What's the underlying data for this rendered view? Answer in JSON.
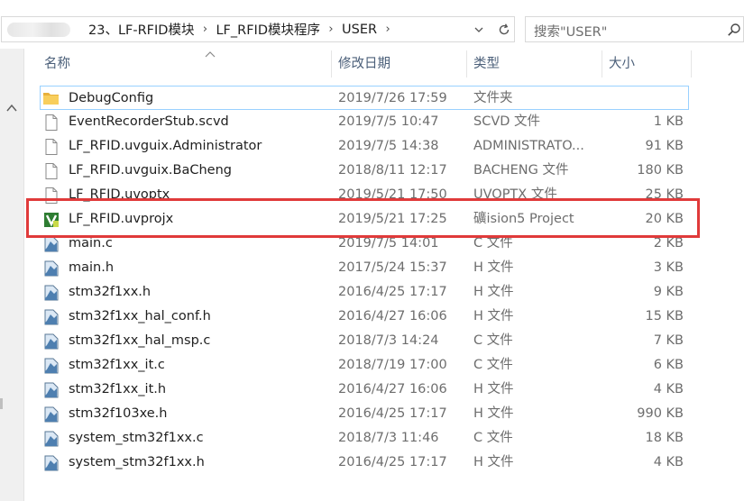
{
  "address_bar": {
    "crumbs": [
      "23、LF-RFID模块",
      "LF_RFID模块程序",
      "USER"
    ]
  },
  "search": {
    "placeholder": "搜索\"USER\""
  },
  "columns": {
    "name": "名称",
    "date": "修改日期",
    "type": "类型",
    "size": "大小"
  },
  "files": [
    {
      "icon": "folder-icon",
      "name": "DebugConfig",
      "date": "2019/7/26 17:59",
      "type": "文件夹",
      "size": ""
    },
    {
      "icon": "file-icon",
      "name": "EventRecorderStub.scvd",
      "date": "2019/7/5 10:47",
      "type": "SCVD 文件",
      "size": "1 KB"
    },
    {
      "icon": "file-icon",
      "name": "LF_RFID.uvguix.Administrator",
      "date": "2019/7/5 14:38",
      "type": "ADMINISTRATO...",
      "size": "91 KB"
    },
    {
      "icon": "file-icon",
      "name": "LF_RFID.uvguix.BaCheng",
      "date": "2018/8/11 12:17",
      "type": "BACHENG 文件",
      "size": "180 KB"
    },
    {
      "icon": "file-icon",
      "name": "LF_RFID.uvoptx",
      "date": "2019/5/21 17:50",
      "type": "UVOPTX 文件",
      "size": "25 KB"
    },
    {
      "icon": "keil-project-icon",
      "name": "LF_RFID.uvprojx",
      "date": "2019/5/21 17:25",
      "type": "礦ision5 Project",
      "size": "20 KB"
    },
    {
      "icon": "c-source-icon",
      "name": "main.c",
      "date": "2019/7/5 14:01",
      "type": "C 文件",
      "size": "2 KB"
    },
    {
      "icon": "c-source-icon",
      "name": "main.h",
      "date": "2017/5/24 15:37",
      "type": "H 文件",
      "size": "3 KB"
    },
    {
      "icon": "c-source-icon",
      "name": "stm32f1xx.h",
      "date": "2016/4/25 17:17",
      "type": "H 文件",
      "size": "9 KB"
    },
    {
      "icon": "c-source-icon",
      "name": "stm32f1xx_hal_conf.h",
      "date": "2016/4/27 16:06",
      "type": "H 文件",
      "size": "15 KB"
    },
    {
      "icon": "c-source-icon",
      "name": "stm32f1xx_hal_msp.c",
      "date": "2018/7/3 14:24",
      "type": "C 文件",
      "size": "7 KB"
    },
    {
      "icon": "c-source-icon",
      "name": "stm32f1xx_it.c",
      "date": "2018/7/19 17:00",
      "type": "C 文件",
      "size": "6 KB"
    },
    {
      "icon": "c-source-icon",
      "name": "stm32f1xx_it.h",
      "date": "2016/4/27 16:06",
      "type": "H 文件",
      "size": "4 KB"
    },
    {
      "icon": "c-source-icon",
      "name": "stm32f103xe.h",
      "date": "2016/4/25 17:17",
      "type": "H 文件",
      "size": "990 KB"
    },
    {
      "icon": "c-source-icon",
      "name": "system_stm32f1xx.c",
      "date": "2018/7/3 11:46",
      "type": "C 文件",
      "size": "18 KB"
    },
    {
      "icon": "c-source-icon",
      "name": "system_stm32f1xx.h",
      "date": "2016/4/25 17:17",
      "type": "H 文件",
      "size": "4 KB"
    }
  ],
  "colors": {
    "highlight": "#e03a3a",
    "focus": "#99d1ff",
    "header_text": "#4c607a"
  }
}
